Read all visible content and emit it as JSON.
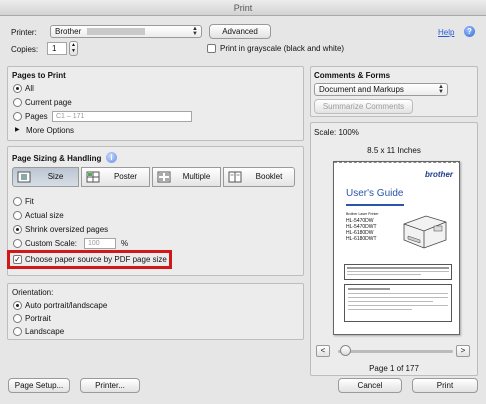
{
  "window": {
    "title": "Print"
  },
  "printer": {
    "label": "Printer:",
    "value": "Brother",
    "advanced_label": "Advanced",
    "help_label": "Help"
  },
  "copies": {
    "label": "Copies:",
    "value": "1",
    "grayscale_label": "Print in grayscale (black and white)",
    "grayscale_checked": false
  },
  "pages": {
    "heading": "Pages to Print",
    "all_label": "All",
    "current_label": "Current page",
    "pages_label": "Pages",
    "pages_placeholder": "C1 – 171",
    "more_options_label": "More Options",
    "selected": "All"
  },
  "comments": {
    "heading": "Comments & Forms",
    "value": "Document and Markups",
    "summarize_label": "Summarize Comments"
  },
  "sizing": {
    "heading": "Page Sizing & Handling",
    "tabs": [
      "Size",
      "Poster",
      "Multiple",
      "Booklet"
    ],
    "selected_tab": "Size",
    "fit_label": "Fit",
    "actual_label": "Actual size",
    "shrink_label": "Shrink oversized pages",
    "custom_label": "Custom Scale:",
    "custom_value": "100",
    "percent": "%",
    "paper_source_label": "Choose paper source by PDF page size",
    "paper_source_checked": true,
    "selected_option": "Shrink oversized pages"
  },
  "orientation": {
    "heading": "Orientation:",
    "auto_label": "Auto portrait/landscape",
    "portrait_label": "Portrait",
    "landscape_label": "Landscape",
    "selected": "Auto portrait/landscape"
  },
  "preview": {
    "scale": "Scale: 100%",
    "paper_size": "8.5 x 11 Inches",
    "brand": "brother",
    "doc_title": "User's Guide",
    "model_heading": "Brother Laser Printer",
    "models": [
      "HL-5470DW",
      "HL-5470DWT",
      "HL-6180DW",
      "HL-6180DWT"
    ],
    "page_indicator": "Page 1 of 177",
    "prev_label": "<",
    "next_label": ">",
    "slider_position": 0
  },
  "footer": {
    "page_setup_label": "Page Setup...",
    "printer_label": "Printer...",
    "cancel_label": "Cancel",
    "print_label": "Print"
  },
  "colors": {
    "highlight_border": "#d01818",
    "accent": "#2f67d8"
  }
}
